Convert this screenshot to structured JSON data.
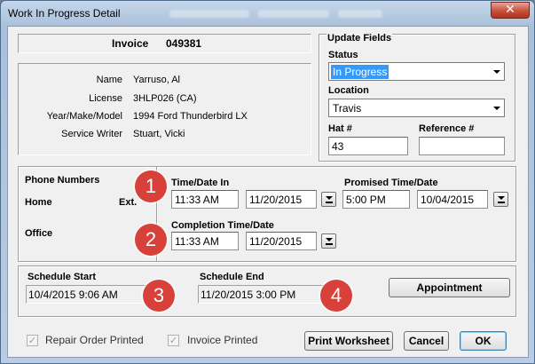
{
  "window": {
    "title": "Work In Progress Detail",
    "close_glyph": "✕"
  },
  "invoice": {
    "label": "Invoice",
    "number": "049381"
  },
  "customer": {
    "name_label": "Name",
    "name": "Yarruso, Al",
    "license_label": "License",
    "license": "3HLP026 (CA)",
    "ymm_label": "Year/Make/Model",
    "ymm": "1994 Ford Thunderbird LX",
    "writer_label": "Service Writer",
    "writer": "Stuart, Vicki"
  },
  "update_fields": {
    "heading": "Update Fields",
    "status_label": "Status",
    "status_value": "In Progress",
    "location_label": "Location",
    "location_value": "Travis",
    "hat_label": "Hat #",
    "hat_value": "43",
    "reference_label": "Reference #",
    "reference_value": ""
  },
  "phone": {
    "heading": "Phone Numbers",
    "home_label": "Home",
    "ext_label": "Ext.",
    "office_label": "Office"
  },
  "times": {
    "in_label": "Time/Date In",
    "in_time": "11:33 AM",
    "in_date": "11/20/2015",
    "promised_label": "Promised Time/Date",
    "promised_time": "5:00 PM",
    "promised_date": "10/04/2015",
    "completion_label": "Completion Time/Date",
    "completion_time": "11:33 AM",
    "completion_date": "11/20/2015"
  },
  "schedule": {
    "start_label": "Schedule Start",
    "start_value": "10/4/2015 9:06 AM",
    "end_label": "Schedule End",
    "end_value": "11/20/2015 3:00 PM",
    "appointment_button": "Appointment"
  },
  "footer": {
    "repair_order_label": "Repair Order Printed",
    "repair_order_checked": true,
    "invoice_printed_label": "Invoice Printed",
    "invoice_printed_checked": true,
    "check_glyph": "✓",
    "print_worksheet_button": "Print Worksheet",
    "cancel_button": "Cancel",
    "ok_button": "OK"
  },
  "callouts": [
    "1",
    "2",
    "3",
    "4"
  ],
  "colors": {
    "callout": "#d7413a",
    "selection": "#3399ff",
    "title_bar": "#b9cde4"
  }
}
